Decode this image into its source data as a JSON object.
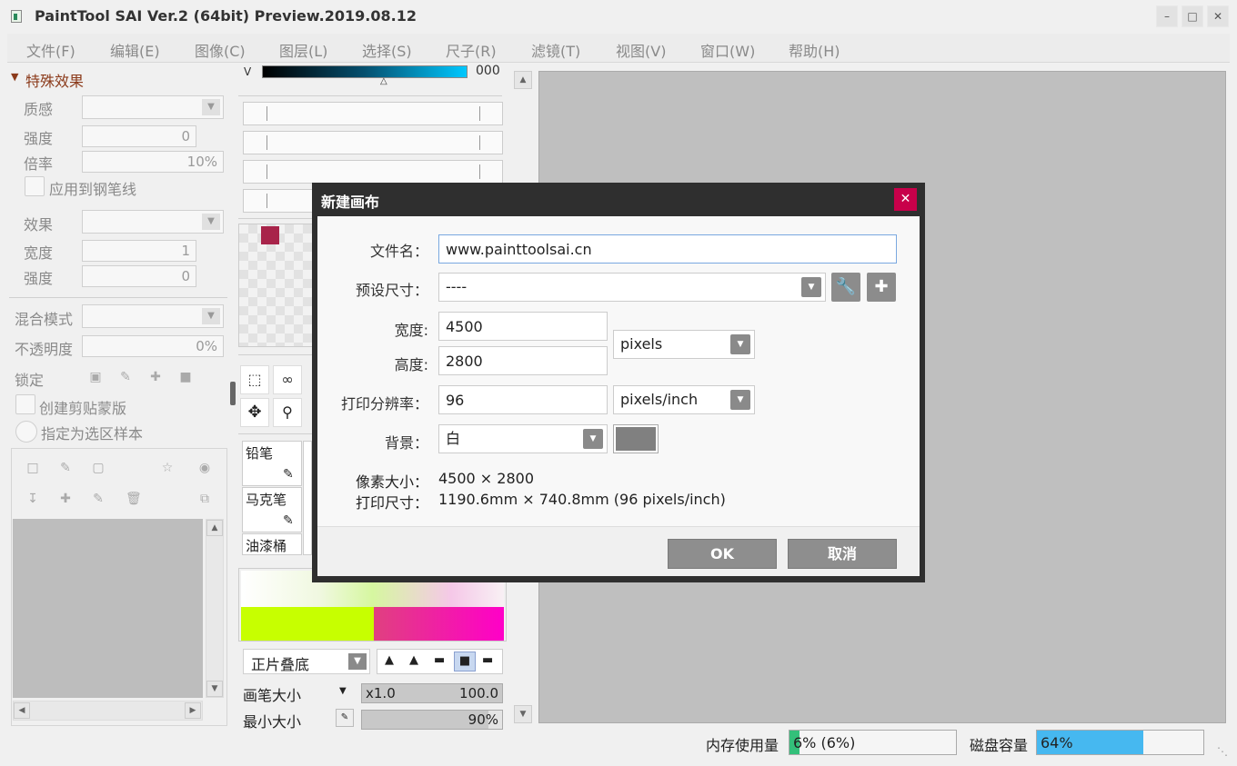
{
  "app": {
    "title": "PaintTool SAI Ver.2 (64bit) Preview.2019.08.12",
    "min_icon": "minimize-icon",
    "max_icon": "maximize-icon",
    "close_icon": "close-icon"
  },
  "menu": [
    "文件(F)",
    "编辑(E)",
    "图像(C)",
    "图层(L)",
    "选择(S)",
    "尺子(R)",
    "滤镜(T)",
    "视图(V)",
    "窗口(W)",
    "帮助(H)"
  ],
  "effects": {
    "header": "特殊效果",
    "texture_label": "质感",
    "strength_label": "强度",
    "strength_value": "0",
    "scale_label": "倍率",
    "scale_value": "10%",
    "apply_pen_label": "应用到钢笔线",
    "effect_label": "效果",
    "width_label": "宽度",
    "width_value": "1",
    "strength2_label": "强度",
    "strength2_value": "0"
  },
  "layer": {
    "blend_label": "混合模式",
    "opacity_label": "不透明度",
    "opacity_value": "0%",
    "lock_label": "锁定",
    "clip_label": "创建剪贴蒙版",
    "sample_label": "指定为选区样本"
  },
  "color": {
    "v_label": "V",
    "v_value": "000",
    "swatch": "#a8244a",
    "green": "#c7ff00",
    "magenta": "#ff00c8"
  },
  "tools": {
    "brushes": [
      {
        "name": "铅笔"
      },
      {
        "name": "马克笔"
      },
      {
        "name": "油漆桶"
      }
    ],
    "blend_mode": "正片叠底",
    "brush_size_label": "画笔大小",
    "brush_size_mult": "x1.0",
    "brush_size_value": "100.0",
    "min_size_label": "最小大小",
    "min_size_value": "90%"
  },
  "dialog": {
    "title": "新建画布",
    "filename_label": "文件名：",
    "filename_value": "www.painttoolsai.cn",
    "preset_label": "预设尺寸：",
    "preset_value": "----",
    "width_label": "宽度:",
    "width_value": "4500",
    "height_label": "高度:",
    "height_value": "2800",
    "unit_value": "pixels",
    "resolution_label": "打印分辨率：",
    "resolution_value": "96",
    "res_unit_value": "pixels/inch",
    "bg_label": "背景：",
    "bg_value": "白",
    "bg_color": "#808080",
    "pixel_size_label": "像素大小：",
    "pixel_size_value": "4500 × 2800",
    "print_size_label": "打印尺寸：",
    "print_size_value": "1190.6mm × 740.8mm (96 pixels/inch)",
    "ok_label": "OK",
    "cancel_label": "取消"
  },
  "status": {
    "memory_label": "内存使用量",
    "memory_value": "6% (6%)",
    "memory_fraction": 0.06,
    "disk_label": "磁盘容量",
    "disk_value": "64%",
    "disk_fraction": 0.64
  }
}
